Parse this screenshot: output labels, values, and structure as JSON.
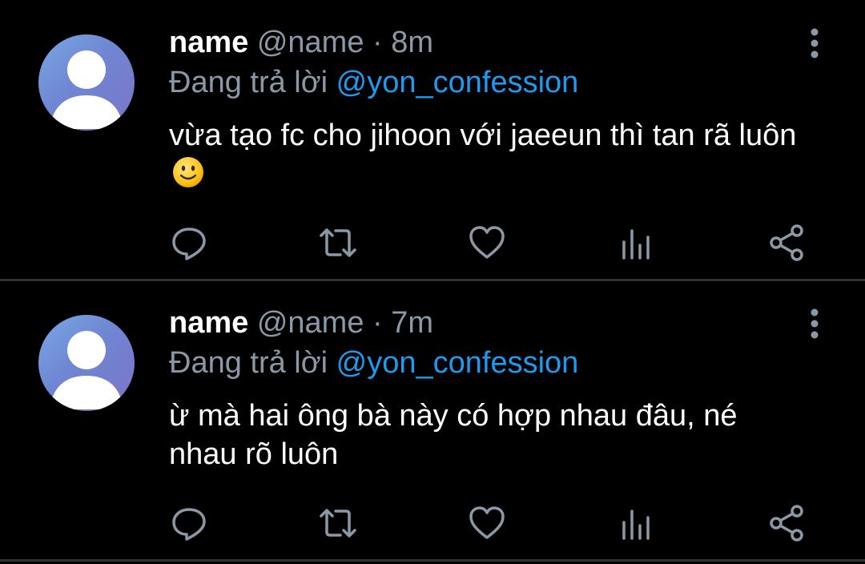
{
  "tweets": [
    {
      "author_name": "name",
      "handle": "@name",
      "separator": "·",
      "time": "8m",
      "reply_prefix": "Đang trả lời",
      "reply_to": "@yon_confession",
      "text": "vừa tạo fc cho jihoon với jaeeun thì tan rã luôn",
      "emoji": "slightly-smiling-face"
    },
    {
      "author_name": "name",
      "handle": "@name",
      "separator": "·",
      "time": "7m",
      "reply_prefix": "Đang trả lời",
      "reply_to": "@yon_confession",
      "text": "ừ mà hai ông bà này có hợp nhau đâu, né nhau rõ luôn"
    }
  ],
  "icons": {
    "more": "more-vertical-icon",
    "reply": "reply-icon",
    "retweet": "retweet-icon",
    "like": "heart-icon",
    "views": "views-icon",
    "share": "share-icon"
  },
  "colors": {
    "background": "#000000",
    "mention": "#1d9bf0",
    "secondary_text": "#8b98a5",
    "divider": "#2f3336"
  }
}
